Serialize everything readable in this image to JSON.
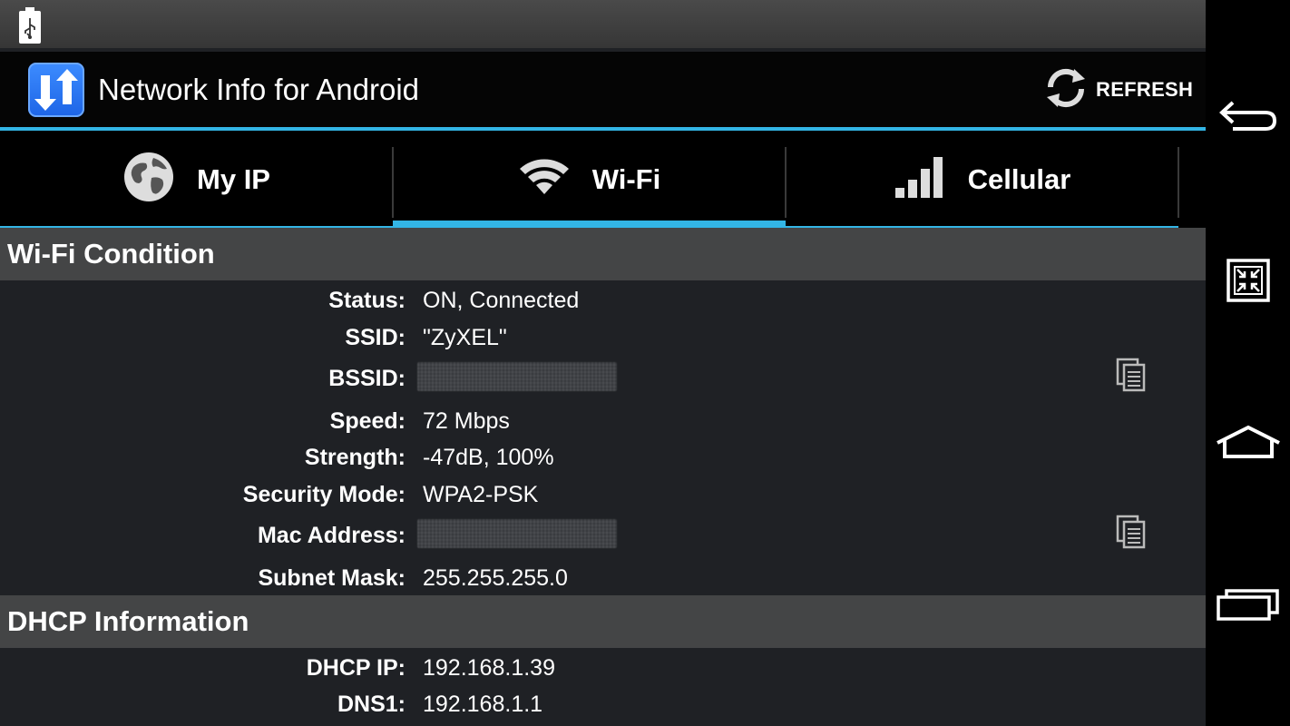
{
  "status_bar": {
    "usb_icon": "usb-debugging-icon"
  },
  "app": {
    "title": "Network Info for Android",
    "icon": "up-down-arrows-icon",
    "refresh_label": "REFRESH",
    "accent_color": "#33b5e5"
  },
  "tabs": [
    {
      "label": "My IP",
      "icon": "globe-icon",
      "selected": false
    },
    {
      "label": "Wi-Fi",
      "icon": "wifi-icon",
      "selected": true
    },
    {
      "label": "Cellular",
      "icon": "signal-bars-icon",
      "selected": false
    }
  ],
  "wifi_condition": {
    "title": "Wi-Fi Condition",
    "rows": [
      {
        "label": "Status:",
        "value": "ON, Connected"
      },
      {
        "label": "SSID:",
        "value": "\"ZyXEL\""
      },
      {
        "label": "BSSID:",
        "value": ""
      },
      {
        "label": "Speed:",
        "value": "72 Mbps"
      },
      {
        "label": "Strength:",
        "value": "-47dB, 100%"
      },
      {
        "label": "Security Mode:",
        "value": "WPA2-PSK"
      },
      {
        "label": "Mac Address:",
        "value": ""
      },
      {
        "label": "Subnet Mask:",
        "value": "255.255.255.0"
      }
    ]
  },
  "dhcp": {
    "title": "DHCP Information",
    "rows": [
      {
        "label": "DHCP IP:",
        "value": "192.168.1.39"
      },
      {
        "label": "DNS1:",
        "value": "192.168.1.1"
      }
    ]
  },
  "nav": {
    "back": "back-icon",
    "screen": "compat-zoom-icon",
    "home": "home-icon",
    "recents": "recents-icon"
  }
}
